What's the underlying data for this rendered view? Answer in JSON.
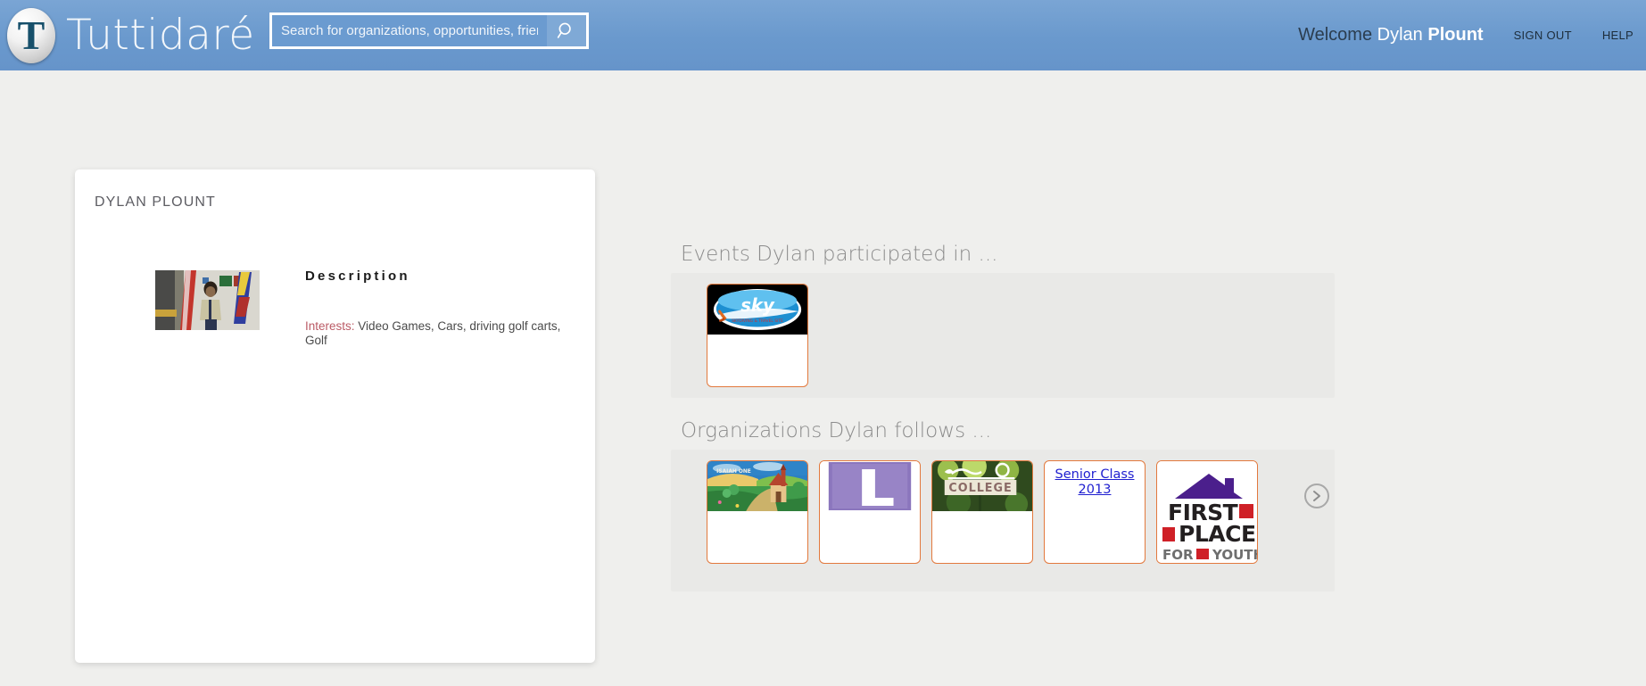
{
  "header": {
    "brand_name": "Tuttidaré",
    "logo_letter": "T",
    "search": {
      "placeholder": "Search for organizations, opportunities, friends",
      "value": "",
      "icon": "search-icon"
    },
    "welcome_prefix": "Welcome",
    "user_first_name": "Dylan",
    "user_last_name": "Plount",
    "sign_out_label": "SIGN OUT",
    "help_label": "HELP",
    "background_color": "#6b9bd0"
  },
  "profile": {
    "name": "DYLAN PLOUNT",
    "avatar_alt": "person-standing-with-flags",
    "description_title": "Description",
    "interests_label": "Interests:",
    "interests_value": "Video Games, Cars, driving golf carts, Golf",
    "label_color": "#bb5b66"
  },
  "events": {
    "heading": "Events Dylan participated in ...",
    "items": [
      {
        "name": "Sky",
        "image": "sky-logo",
        "link_text": ""
      }
    ]
  },
  "organizations": {
    "heading": "Organizations Dylan follows ...",
    "items": [
      {
        "name": "Church Landscape Painting",
        "image": "church-landscape",
        "link_text": ""
      },
      {
        "name": "Purple L Logo",
        "image": "purple-l-logo",
        "link_text": ""
      },
      {
        "name": "College Sign",
        "image": "college-sign",
        "link_text": ""
      },
      {
        "name": "Senior Class 2013",
        "image": "",
        "link_text": "Senior Class 2013"
      },
      {
        "name": "First Place For Youth",
        "image": "first-place-for-youth",
        "link_text": ""
      }
    ],
    "next_label": "›"
  },
  "colors": {
    "page_background": "#efefed",
    "panel_background": "#e9e9e7",
    "tile_border": "#e2793d",
    "link": "#1f1fd0",
    "heading": "#8b8b8b"
  }
}
